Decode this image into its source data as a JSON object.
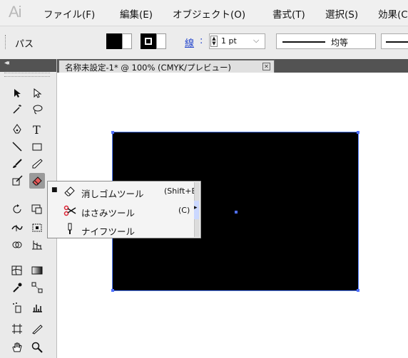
{
  "app": {
    "logo": "Ai"
  },
  "menubar": {
    "items": [
      "ファイル(F)",
      "編集(E)",
      "オブジェクト(O)",
      "書式(T)",
      "選択(S)",
      "効果(C"
    ]
  },
  "controlbar": {
    "selection_label": "パス",
    "stroke_link": "線",
    "stroke_colon": ":",
    "stroke_weight": "1 pt",
    "stroke_profile": "均等",
    "fill_color": "#000000",
    "stroke_color": "#000000"
  },
  "document": {
    "tab_title": "名称未設定-1* @ 100% (CMYK/プレビュー)",
    "artwork_color": "#000000",
    "selection_color": "#4f6fff"
  },
  "toolbox": {
    "tools": [
      "selection-tool",
      "direct-selection-tool",
      "magic-wand-tool",
      "lasso-tool",
      "pen-tool",
      "type-tool",
      "line-tool",
      "rectangle-tool",
      "paintbrush-tool",
      "pencil-tool",
      "blob-brush-tool",
      "eraser-tool",
      "rotate-tool",
      "scale-tool",
      "width-tool",
      "free-transform-tool",
      "shape-builder-tool",
      "perspective-grid-tool",
      "mesh-tool",
      "gradient-tool",
      "eyedropper-tool",
      "blend-tool",
      "symbol-sprayer-tool",
      "column-graph-tool",
      "artboard-tool",
      "slice-tool",
      "hand-tool",
      "zoom-tool"
    ],
    "selected": "eraser-tool"
  },
  "flyout": {
    "items": [
      {
        "label": "消しゴムツール",
        "shortcut": "(Shift+E)",
        "icon": "eraser-icon",
        "active": true
      },
      {
        "label": "はさみツール",
        "shortcut": "(C)",
        "icon": "scissors-icon",
        "active": false
      },
      {
        "label": "ナイフツール",
        "shortcut": "",
        "icon": "knife-icon",
        "active": false
      }
    ],
    "active_bullet": "■",
    "submenu_arrow": "▸"
  }
}
